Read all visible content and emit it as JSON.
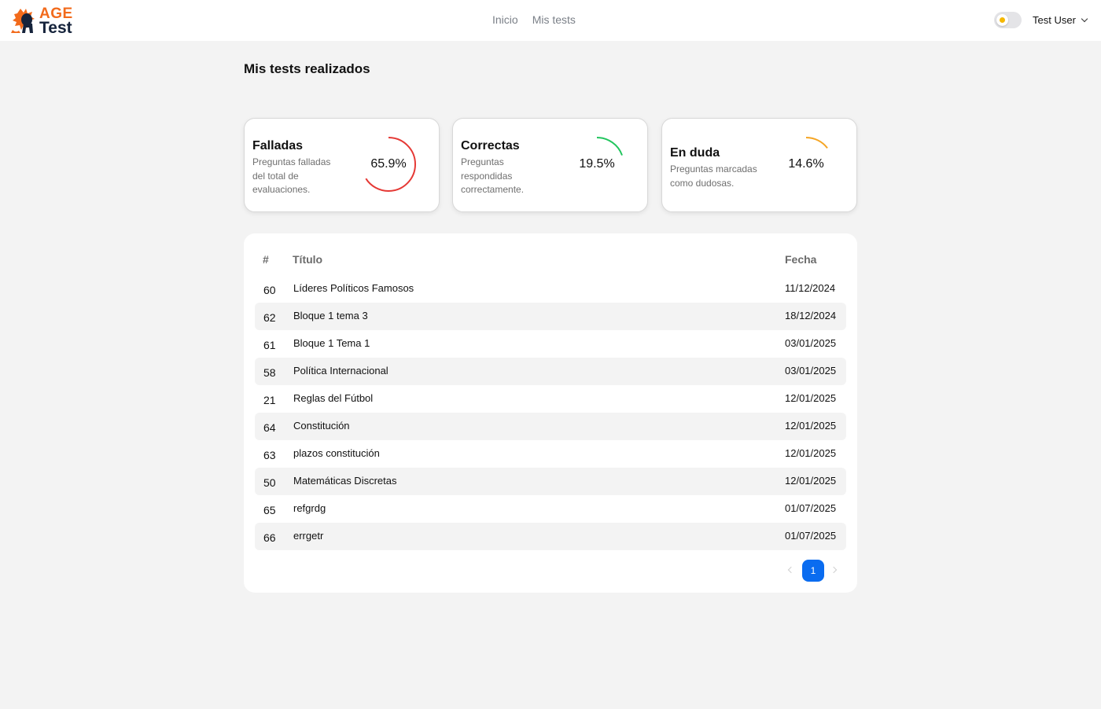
{
  "brand": {
    "line1": "AGE",
    "line2": "Test"
  },
  "nav": {
    "links": [
      "Inicio",
      "Mis tests"
    ]
  },
  "user": {
    "name": "Test User"
  },
  "page": {
    "title": "Mis tests realizados"
  },
  "stats": [
    {
      "title": "Falladas",
      "description": "Preguntas falladas del total de evaluaciones.",
      "percent_label": "65.9%",
      "value": 65.9,
      "color": "#e53935"
    },
    {
      "title": "Correctas",
      "description": "Preguntas respondidas correctamente.",
      "percent_label": "19.5%",
      "value": 19.5,
      "color": "#22c55e"
    },
    {
      "title": "En duda",
      "description": "Preguntas marcadas como dudosas.",
      "percent_label": "14.6%",
      "value": 14.6,
      "color": "#f5a524"
    }
  ],
  "table": {
    "headers": {
      "num": "#",
      "title": "Título",
      "date": "Fecha"
    },
    "rows": [
      {
        "num": "60",
        "title": "Líderes Políticos Famosos",
        "date": "11/12/2024"
      },
      {
        "num": "62",
        "title": "Bloque 1 tema 3",
        "date": "18/12/2024"
      },
      {
        "num": "61",
        "title": "Bloque 1 Tema 1",
        "date": "03/01/2025"
      },
      {
        "num": "58",
        "title": "Política Internacional",
        "date": "03/01/2025"
      },
      {
        "num": "21",
        "title": "Reglas del Fútbol",
        "date": "12/01/2025"
      },
      {
        "num": "64",
        "title": "Constitución",
        "date": "12/01/2025"
      },
      {
        "num": "63",
        "title": "plazos constitución",
        "date": "12/01/2025"
      },
      {
        "num": "50",
        "title": "Matemáticas Discretas",
        "date": "12/01/2025"
      },
      {
        "num": "65",
        "title": "refgrdg",
        "date": "01/07/2025"
      },
      {
        "num": "66",
        "title": "errgetr",
        "date": "01/07/2025"
      }
    ]
  },
  "pagination": {
    "current_page": "1"
  }
}
